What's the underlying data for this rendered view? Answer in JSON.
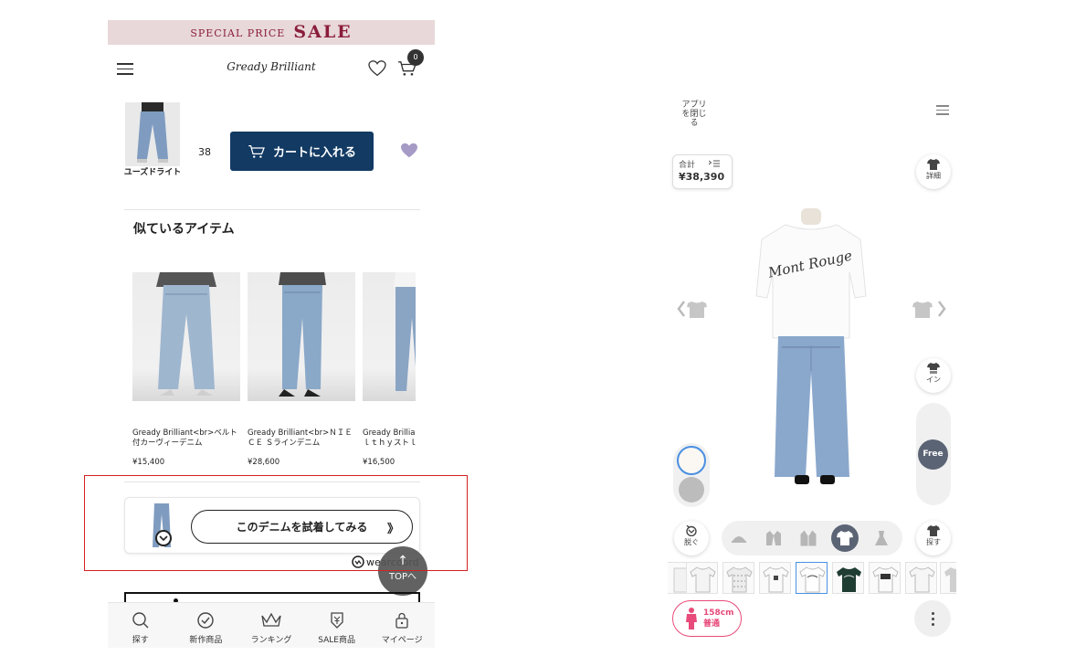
{
  "left": {
    "banner": {
      "small": "SPECIAL PRICE",
      "big": "SALE"
    },
    "header": {
      "logo": "Gready Brilliant",
      "cart_count": "0"
    },
    "selection": {
      "color_label": "ユーズドライト",
      "size": "38",
      "add_to_cart": "カートに入れる"
    },
    "similar": {
      "title": "似ているアイテム",
      "items": [
        {
          "name1": "Gready Brilliant<br>ベルト",
          "name2": "付カーヴィーデニム",
          "price": "¥15,400"
        },
        {
          "name1": "Gready Brilliant<br>ＮＩＥ",
          "name2": "ＣＥ Ｓラインデニム",
          "price": "¥28,600"
        },
        {
          "name1": "Gready Brillia",
          "name2": "ｌｔｈｙストｌ",
          "price": "¥16,500"
        }
      ]
    },
    "tryon": {
      "button": "このデニムを試着してみる",
      "chevrons": "》",
      "brand": "wearcoord"
    },
    "top_button": {
      "arrow": "↑",
      "label": "TOPへ"
    },
    "tabs": [
      {
        "label": "探す",
        "icon": "search-icon"
      },
      {
        "label": "新作商品",
        "icon": "check-circle-icon"
      },
      {
        "label": "ランキング",
        "icon": "crown-icon"
      },
      {
        "label": "SALE商品",
        "icon": "sale-tag-icon"
      },
      {
        "label": "マイページ",
        "icon": "lock-icon"
      }
    ]
  },
  "right": {
    "close_app": "アプリを閉じる",
    "total": {
      "label": "合計",
      "value": "¥38,390"
    },
    "detail_label": "詳細",
    "tuck_label": "イン",
    "size_label": "Free",
    "undress_label": "脱ぐ",
    "search_label": "探す",
    "height_chip": {
      "height": "158cm",
      "build": "普通"
    },
    "tshirt_print": "Mont Rouge",
    "colors": {
      "accent": "#4a90e2",
      "active": "#5b6475",
      "pink": "#e84a7a"
    }
  }
}
